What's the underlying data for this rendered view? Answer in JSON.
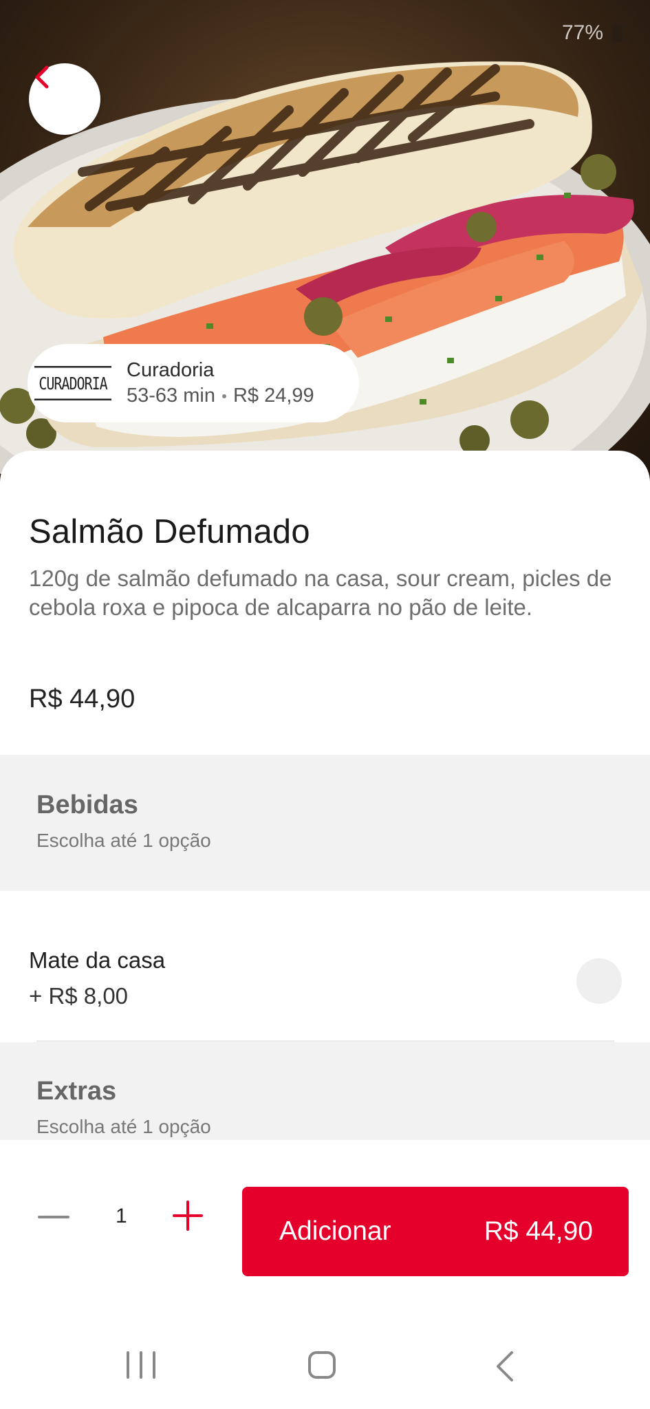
{
  "status_bar": {
    "battery": "77%"
  },
  "restaurant": {
    "logo_text": "CURADORIA",
    "name": "Curadoria",
    "delivery_time": "53-63 min",
    "delivery_fee": "R$ 24,99"
  },
  "product": {
    "title": "Salmão Defumado",
    "description": "120g de salmão defumado na casa, sour cream, picles de cebola roxa e pipoca de alcaparra no pão de leite.",
    "price": "R$ 44,90"
  },
  "sections": [
    {
      "title": "Bebidas",
      "subtitle": "Escolha até 1 opção",
      "options": [
        {
          "name": "Mate da casa",
          "price": "+ R$ 8,00",
          "selected": false
        }
      ]
    },
    {
      "title": "Extras",
      "subtitle": "Escolha até 1 opção"
    }
  ],
  "cart": {
    "quantity": "1",
    "add_label": "Adicionar",
    "add_total": "R$ 44,90"
  },
  "colors": {
    "accent": "#e4002b",
    "section_bg": "#f2f2f2"
  }
}
